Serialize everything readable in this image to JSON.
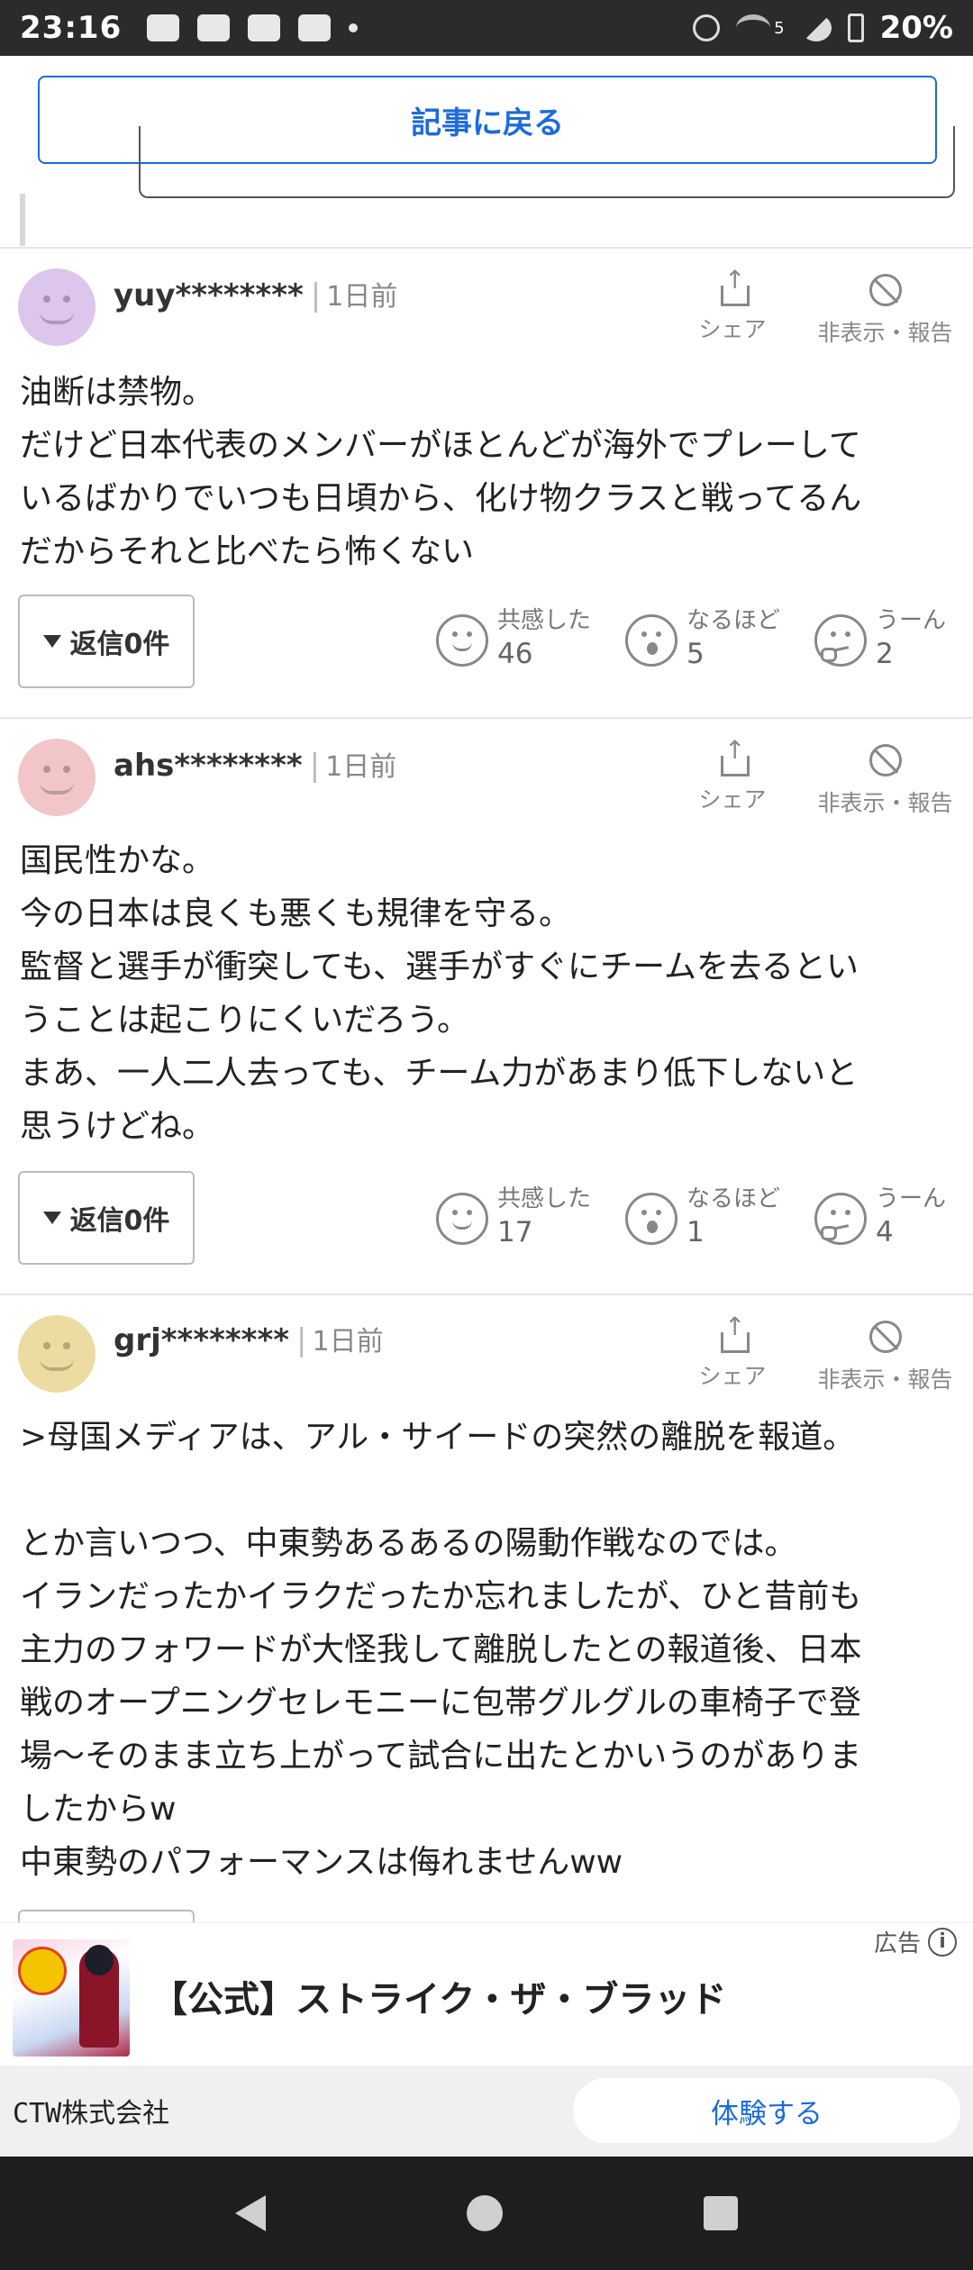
{
  "status_bar": {
    "time": "23:16",
    "network": "5",
    "battery": "20%"
  },
  "back_button": {
    "label": "記事に戻る"
  },
  "comments": [
    {
      "username": "yuy********",
      "time": "1日前",
      "avatar_color": "#dcc6ec",
      "share_label": "シェア",
      "hide_label": "非表示・報告",
      "lines": [
        "油断は禁物。",
        "だけど日本代表のメンバーがほとんどが海外でプレーして",
        "いるばかりでいつも日頃から、化け物クラスと戦ってるん",
        "だからそれと比べたら怖くない"
      ],
      "reply_label": "返信0件",
      "reactions": [
        {
          "label": "共感した",
          "count": "46",
          "icon": "smile-icon"
        },
        {
          "label": "なるほど",
          "count": "5",
          "icon": "surprised-icon"
        },
        {
          "label": "うーん",
          "count": "2",
          "icon": "thinking-icon"
        }
      ]
    },
    {
      "username": "ahs********",
      "time": "1日前",
      "avatar_color": "#f2c6c8",
      "share_label": "シェア",
      "hide_label": "非表示・報告",
      "lines": [
        "国民性かな。",
        "今の日本は良くも悪くも規律を守る。",
        "監督と選手が衝突しても、選手がすぐにチームを去るとい",
        "うことは起こりにくいだろう。",
        "まあ、一人二人去っても、チーム力があまり低下しないと",
        "思うけどね。"
      ],
      "reply_label": "返信0件",
      "reactions": [
        {
          "label": "共感した",
          "count": "17",
          "icon": "smile-icon"
        },
        {
          "label": "なるほど",
          "count": "1",
          "icon": "surprised-icon"
        },
        {
          "label": "うーん",
          "count": "4",
          "icon": "thinking-icon"
        }
      ]
    },
    {
      "username": "grj********",
      "time": "1日前",
      "avatar_color": "#ecdca2",
      "share_label": "シェア",
      "hide_label": "非表示・報告",
      "lines": [
        ">母国メディアは、アル・サイードの突然の離脱を報道。",
        "",
        "とか言いつつ、中東勢あるあるの陽動作戦なのでは。",
        "イランだったかイラクだったか忘れましたが、ひと昔前も",
        "主力のフォワードが大怪我して離脱したとの報道後、日本",
        "戦のオープニングセレモニーに包帯グルグルの車椅子で登",
        "場〜そのまま立ち上がって試合に出たとかいうのがありま",
        "したからw",
        "中東勢のパフォーマンスは侮れませんww"
      ]
    }
  ],
  "ad": {
    "label": "広告",
    "title": "【公式】ストライク・ザ・ブラッド",
    "advertiser": "CTW株式会社",
    "cta": "体験する"
  }
}
